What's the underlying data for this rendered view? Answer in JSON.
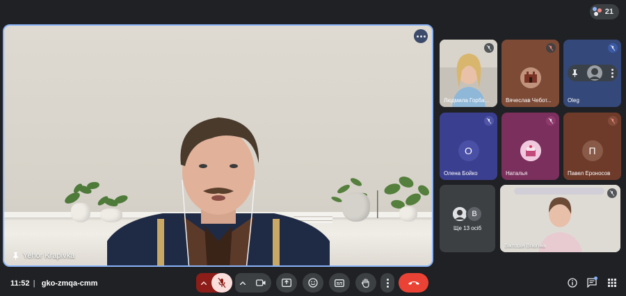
{
  "participant_count": "21",
  "main_speaker": {
    "name": "Yehor Krapivka"
  },
  "tiles": [
    {
      "name": "Людмила Горба...",
      "type": "video",
      "bg": "#b3aea6"
    },
    {
      "name": "Вячеслав Чебот...",
      "type": "avatar-image",
      "bg": "#7d4a36"
    },
    {
      "name": "Oleg",
      "type": "avatar-image",
      "bg": "#34487a"
    },
    {
      "name": "Олена Бойко",
      "type": "initial",
      "initial": "О",
      "bg": "#3b3f8f",
      "avatar_bg": "#4a50a6"
    },
    {
      "name": "Наталья",
      "type": "avatar-image",
      "bg": "#7a2f5c"
    },
    {
      "name": "Павел Ероносов",
      "type": "initial",
      "initial": "П",
      "bg": "#6e3b2b",
      "avatar_bg": "#8a5a48"
    },
    {
      "name": "Ще 13 осіб",
      "type": "more",
      "initial": "B",
      "bg": "#3c4043"
    },
    {
      "name": "Вікторія Вгюгіна",
      "type": "video",
      "bg": "#d9d6d0"
    }
  ],
  "meeting": {
    "time": "11:52",
    "code": "gko-zmqa-cmm"
  },
  "colors": {
    "accent": "#8ab4f8",
    "end_call": "#ea4335",
    "mic_off_bg": "#f9dedc",
    "mic_off_chevron_bg": "#8c1d18"
  },
  "controls": [
    "chevron-up-icon",
    "mic-off-icon",
    "chevron-up-icon",
    "camera-icon",
    "present-icon",
    "emoji-icon",
    "captions-icon",
    "raise-hand-icon",
    "more-vert-icon",
    "end-call-icon"
  ],
  "right_controls": [
    "info-icon",
    "chat-icon",
    "activities-icon"
  ]
}
